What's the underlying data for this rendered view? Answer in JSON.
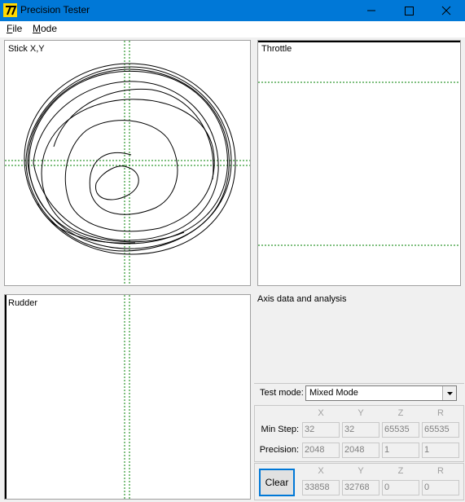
{
  "window": {
    "title": "Precision Tester",
    "icon": "joystick-app-icon"
  },
  "controls": {
    "minimize": "minimize-icon",
    "maximize": "maximize-icon",
    "close": "close-icon"
  },
  "menu": {
    "file": {
      "accel": "F",
      "rest": "ile"
    },
    "mode": {
      "accel": "M",
      "rest": "ode"
    }
  },
  "panels": {
    "stick": "Stick X,Y",
    "throttle": "Throttle",
    "rudder": "Rudder"
  },
  "analysis": {
    "title": "Axis data and analysis"
  },
  "test_mode": {
    "label": "Test mode:",
    "value": "Mixed Mode"
  },
  "stats": {
    "columns": [
      "X",
      "Y",
      "Z",
      "R"
    ],
    "min_step": {
      "label": "Min Step:",
      "values": [
        "32",
        "32",
        "65535",
        "65535"
      ]
    },
    "precision": {
      "label": "Precision:",
      "values": [
        "2048",
        "2048",
        "1",
        "1"
      ]
    }
  },
  "current": {
    "clear_label": "Clear",
    "columns": [
      "X",
      "Y",
      "Z",
      "R"
    ],
    "values": [
      "33858",
      "32768",
      "0",
      "0"
    ]
  },
  "colors": {
    "titlebar": "#0078d7",
    "guide": "#008000",
    "trace": "#000000"
  }
}
